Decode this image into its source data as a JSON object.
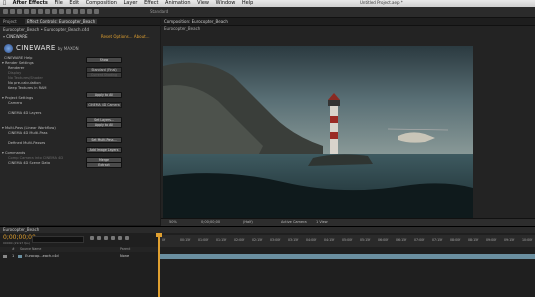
{
  "menubar": {
    "app": "After Effects",
    "items": [
      "File",
      "Edit",
      "Composition",
      "Layer",
      "Effect",
      "Animation",
      "View",
      "Window",
      "Help"
    ],
    "window_title": "Untitled Project.aep *"
  },
  "toolbar": {
    "workspace": "Standard"
  },
  "effects_panel": {
    "tabs": [
      "Project",
      "Effect Controls: Eurocopter_Beach"
    ],
    "breadcrumb": "Eurocopter_Beach • Eurocopter_Beach.c4d",
    "effect_name": "CINEWARE",
    "reset_label": "Reset",
    "options_label": "Options...",
    "about_label": "About...",
    "logo_text": "CINEWARE",
    "logo_sub": "by MAXON",
    "rows": [
      {
        "label": "CINEWARE Help",
        "value": "Show",
        "kind": "button",
        "indent": 4,
        "dim": false
      },
      {
        "label": "▾ Render Settings",
        "value": "",
        "kind": "none",
        "indent": 2,
        "dim": false
      },
      {
        "label": "Renderer",
        "value": "Standard (Final)",
        "kind": "select",
        "indent": 8,
        "dim": false
      },
      {
        "label": "Display",
        "value": "Current Shading",
        "kind": "select",
        "indent": 8,
        "dim": true
      },
      {
        "label": "No Textures/Shader",
        "value": "",
        "kind": "none",
        "indent": 8,
        "dim": true
      },
      {
        "label": "No pre-calculation",
        "value": "",
        "kind": "none",
        "indent": 8,
        "dim": false
      },
      {
        "label": "Keep Textures in RAM",
        "value": "",
        "kind": "none",
        "indent": 8,
        "dim": false
      },
      {
        "label": "",
        "value": "Apply to All",
        "kind": "button",
        "indent": 8,
        "dim": false
      },
      {
        "label": "▾ Project Settings",
        "value": "",
        "kind": "none",
        "indent": 2,
        "dim": false
      },
      {
        "label": "Camera",
        "value": "CINEMA 4D Camera",
        "kind": "select",
        "indent": 8,
        "dim": false
      },
      {
        "label": "",
        "value": "",
        "kind": "none",
        "indent": 8,
        "dim": false
      },
      {
        "label": "CINEMA 4D Layers",
        "value": "",
        "kind": "none",
        "indent": 8,
        "dim": false
      },
      {
        "label": "",
        "value": "Set Layers...",
        "kind": "button",
        "indent": 8,
        "dim": true
      },
      {
        "label": "",
        "value": "Apply to All",
        "kind": "button",
        "indent": 8,
        "dim": false
      },
      {
        "label": "▾ Multi-Pass (Linear Workflow)",
        "value": "",
        "kind": "none",
        "indent": 2,
        "dim": false
      },
      {
        "label": "CINEMA 4D Multi-Pass",
        "value": "",
        "kind": "none",
        "indent": 8,
        "dim": false
      },
      {
        "label": "",
        "value": "Set Multi-Pass...",
        "kind": "button",
        "indent": 8,
        "dim": true
      },
      {
        "label": "Defined Multi-Passes",
        "value": "",
        "kind": "none",
        "indent": 8,
        "dim": false
      },
      {
        "label": "",
        "value": "Add Image Layers",
        "kind": "button",
        "indent": 8,
        "dim": false
      },
      {
        "label": "▾ Commands",
        "value": "",
        "kind": "none",
        "indent": 2,
        "dim": false
      },
      {
        "label": "Comp Camera into CINEMA 4D",
        "value": "Merge",
        "kind": "button",
        "indent": 8,
        "dim": true
      },
      {
        "label": "CINEMA 4D Scene Data",
        "value": "Extract",
        "kind": "button",
        "indent": 8,
        "dim": false
      }
    ]
  },
  "comp_panel": {
    "tab": "Composition: Eurocopter_Beach",
    "breadcrumb": "Eurocopter_Beach",
    "zoom": "50%",
    "timecode": "0;00;00;00",
    "resolution": "(Half)",
    "camera": "Active Camera",
    "views": "1 View"
  },
  "timeline": {
    "tab": "Eurocopter_Beach",
    "timecode": "0;00;00;00",
    "fps_note": "00000 (29.97 fps)",
    "columns": [
      "#",
      "Source Name",
      "Parent"
    ],
    "layer": {
      "index": "1",
      "name": "Eurocop...each.c4d",
      "parent": "None"
    },
    "ruler": [
      "0f",
      "00:15f",
      "01:00f",
      "01:15f",
      "02:00f",
      "02:15f",
      "03:00f",
      "03:15f",
      "04:00f",
      "04:15f",
      "05:00f",
      "05:15f",
      "06:00f",
      "06:15f",
      "07:00f",
      "07:15f",
      "08:00f",
      "08:15f",
      "09:00f",
      "09:15f",
      "10:00f"
    ]
  }
}
